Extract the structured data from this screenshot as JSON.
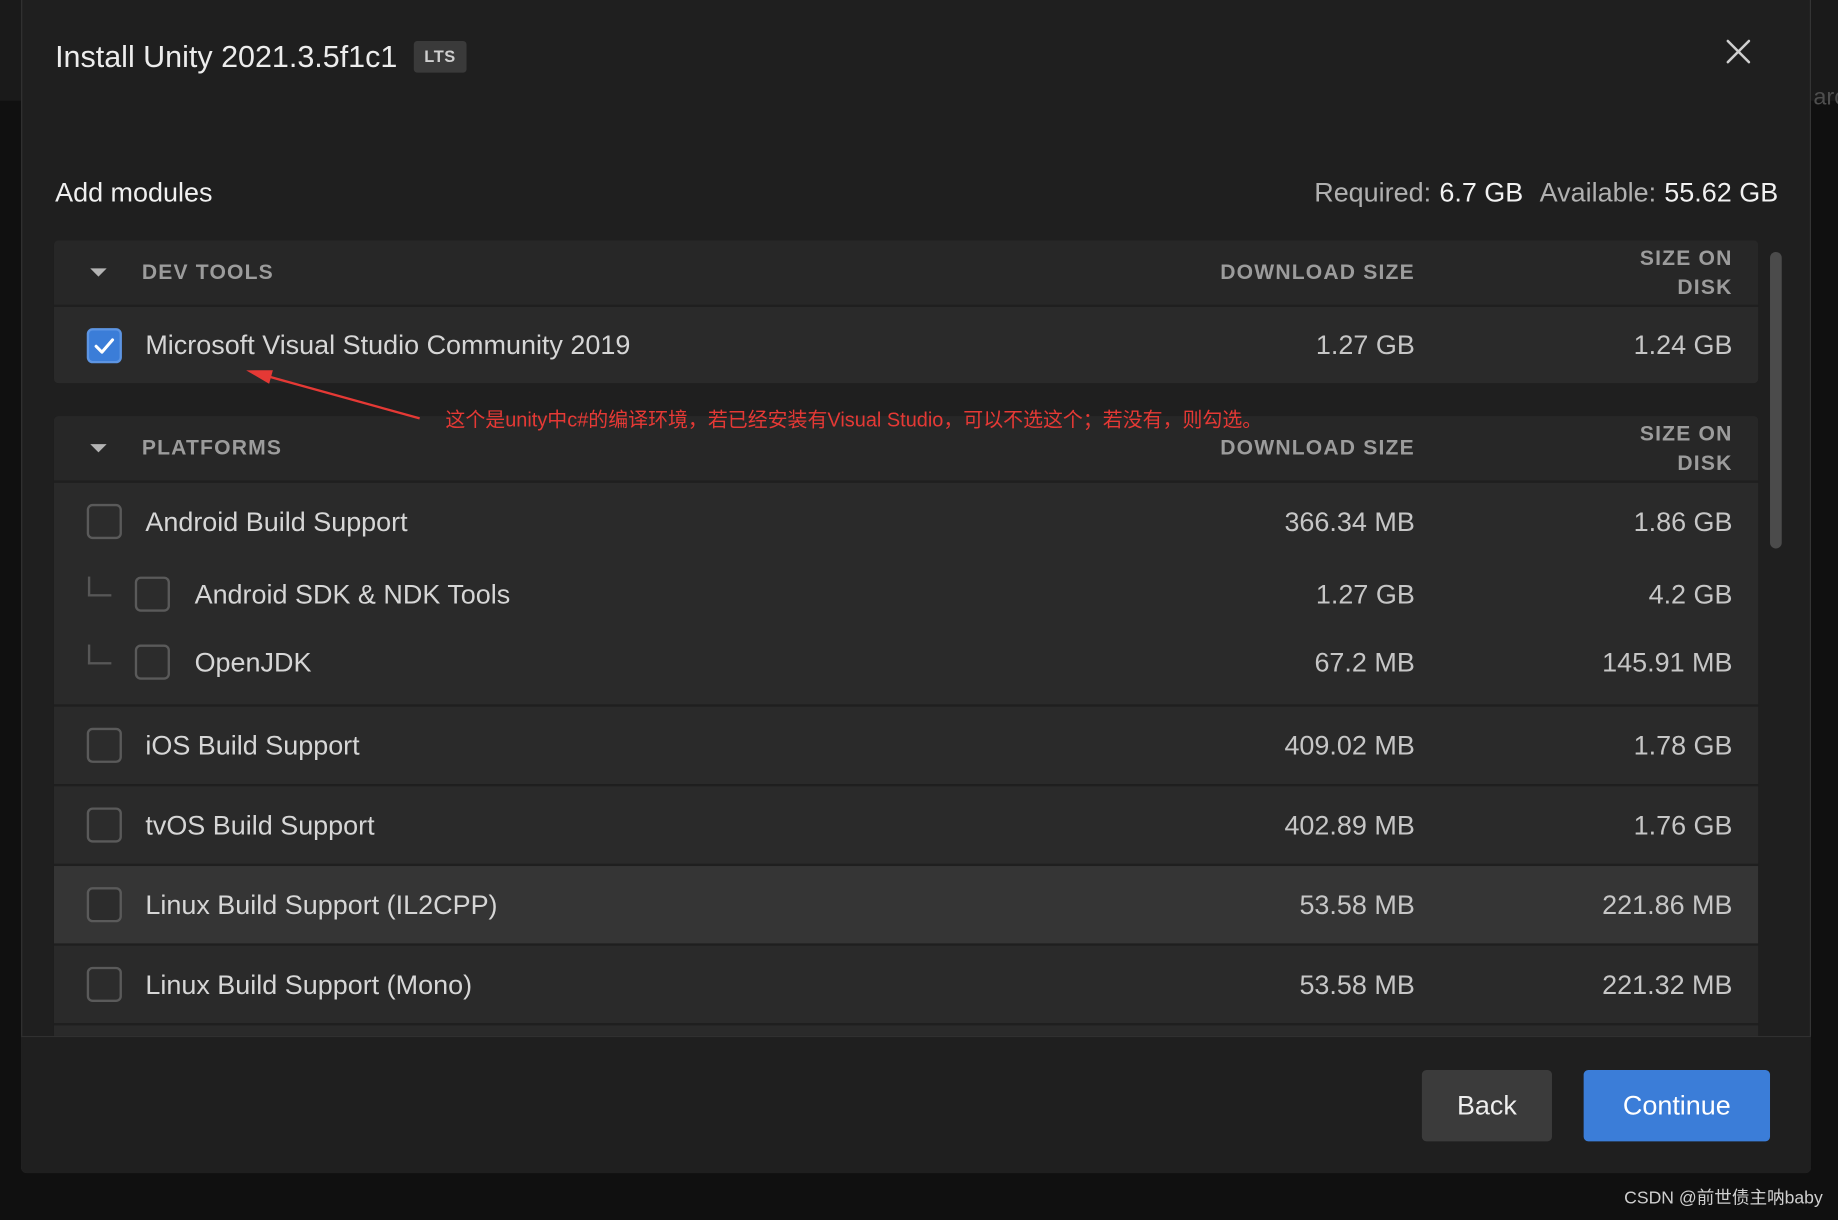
{
  "window": {
    "title": "Install Unity 2021.3.5f1c1",
    "badge": "LTS"
  },
  "modules_header": {
    "title": "Add modules",
    "required_label": "Required:",
    "required_value": "6.7 GB",
    "available_label": "Available:",
    "available_value": "55.62 GB"
  },
  "sections": [
    {
      "name": "DEV TOOLS",
      "download_header": "DOWNLOAD SIZE",
      "disk_header": "SIZE ON DISK",
      "expanded": true,
      "modules": [
        {
          "label": "Microsoft Visual Studio Community 2019",
          "download_size": "1.27 GB",
          "disk_size": "1.24 GB",
          "checked": true
        }
      ]
    },
    {
      "name": "PLATFORMS",
      "download_header": "DOWNLOAD SIZE",
      "disk_header": "SIZE ON DISK",
      "expanded": true,
      "modules": [
        {
          "label": "Android Build Support",
          "download_size": "366.34 MB",
          "disk_size": "1.86 GB",
          "checked": false,
          "children": [
            {
              "label": "Android SDK & NDK Tools",
              "download_size": "1.27 GB",
              "disk_size": "4.2 GB",
              "checked": false
            },
            {
              "label": "OpenJDK",
              "download_size": "67.2 MB",
              "disk_size": "145.91 MB",
              "checked": false
            }
          ]
        },
        {
          "label": "iOS Build Support",
          "download_size": "409.02 MB",
          "disk_size": "1.78 GB",
          "checked": false
        },
        {
          "label": "tvOS Build Support",
          "download_size": "402.89 MB",
          "disk_size": "1.76 GB",
          "checked": false
        },
        {
          "label": "Linux Build Support (IL2CPP)",
          "download_size": "53.58 MB",
          "disk_size": "221.86 MB",
          "checked": false,
          "hovered": true
        },
        {
          "label": "Linux Build Support (Mono)",
          "download_size": "53.58 MB",
          "disk_size": "221.32 MB",
          "checked": false
        }
      ]
    }
  ],
  "annotation": {
    "text": "这个是unity中c#的编译环境，若已经安装有Visual Studio，可以不选这个；若没有，则勾选。"
  },
  "footer": {
    "back_label": "Back",
    "continue_label": "Continue"
  },
  "background": {
    "partial_text": "arc"
  },
  "watermark": "CSDN @前世债主呐baby",
  "colors": {
    "accent": "#3b7dd8",
    "annotation": "#e53935",
    "dialog_background": "#1f1f1f"
  },
  "icons": {
    "close": "close-icon",
    "collapse": "caret-down-icon",
    "check": "checkmark-icon",
    "child": "tree-branch-icon",
    "pointer": "arrow-icon"
  }
}
